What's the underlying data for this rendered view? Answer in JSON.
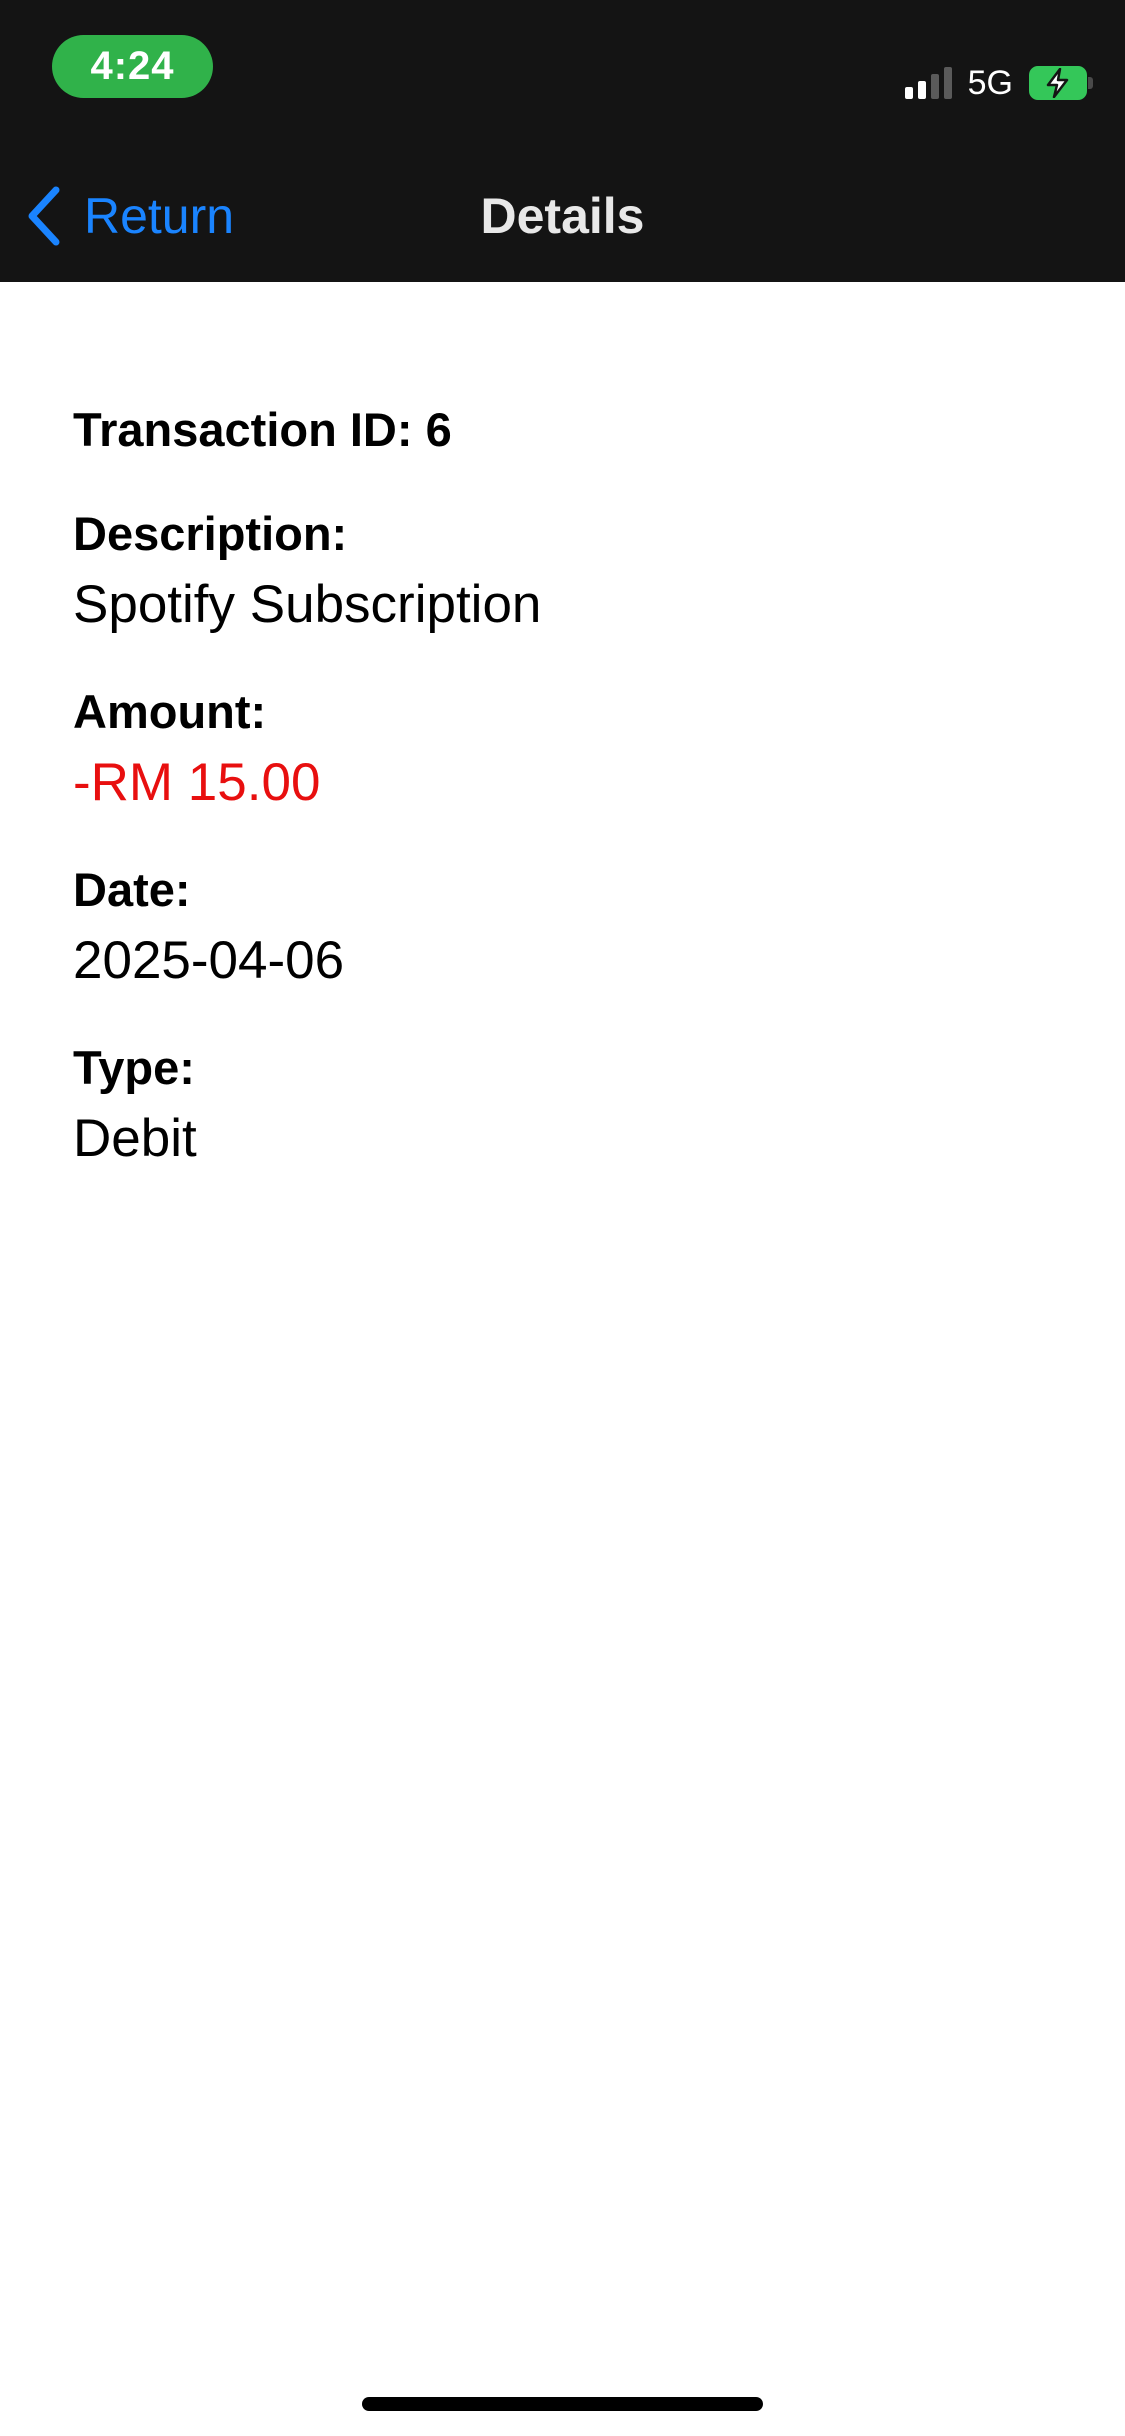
{
  "status_bar": {
    "time": "4:24",
    "network": "5G",
    "battery_color": "#34c759",
    "time_pill_color": "#30b24a"
  },
  "nav": {
    "back_label": "Return",
    "title": "Details",
    "accent_color": "#1a84ff"
  },
  "transaction": {
    "id_label": "Transaction ID: 6",
    "description_label": "Description:",
    "description_value": "Spotify Subscription",
    "amount_label": "Amount:",
    "amount_value": "-RM 15.00",
    "amount_color": "#e80f0f",
    "date_label": "Date:",
    "date_value": "2025-04-06",
    "type_label": "Type:",
    "type_value": "Debit"
  },
  "icons": {
    "back": "chevron-left-icon",
    "signal": "cellular-signal-icon",
    "battery": "battery-charging-icon"
  }
}
